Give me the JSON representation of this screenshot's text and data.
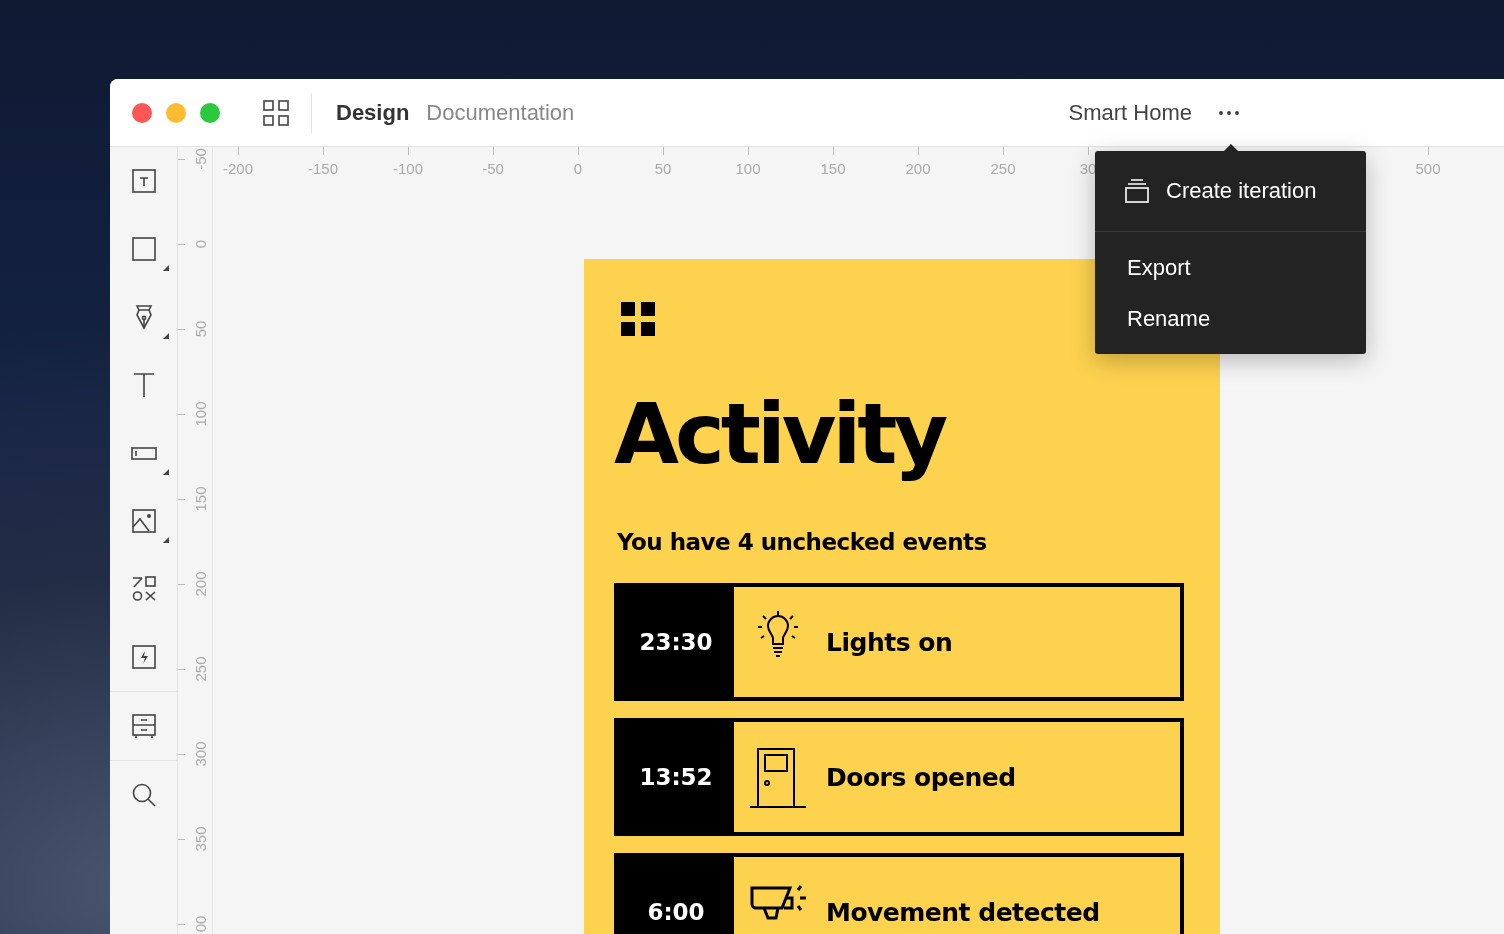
{
  "window": {
    "tabs": [
      {
        "label": "Design",
        "selected": true
      },
      {
        "label": "Documentation",
        "selected": false
      }
    ],
    "project_title": "Smart Home"
  },
  "toolbar": {
    "tool_groups": [
      [
        {
          "has_submenu": false
        },
        {
          "has_submenu": true
        },
        {
          "has_submenu": true
        },
        {
          "has_submenu": false
        },
        {
          "has_submenu": true
        },
        {
          "has_submenu": true
        },
        {
          "has_submenu": false
        },
        {
          "has_submenu": false
        }
      ],
      [
        {
          "has_submenu": false
        }
      ],
      [
        {
          "has_submenu": false
        }
      ]
    ]
  },
  "rulers": {
    "horizontal": [
      "-200",
      "-150",
      "-100",
      "-50",
      "0",
      "50",
      "100",
      "150",
      "200",
      "250",
      "30",
      "500"
    ],
    "vertical": [
      "-50",
      "0",
      "50",
      "100",
      "150",
      "200",
      "250",
      "300",
      "350",
      "00"
    ]
  },
  "menu": {
    "items": [
      {
        "label": "Create iteration",
        "kind": "header"
      },
      {
        "label": "Export",
        "kind": "plain"
      },
      {
        "label": "Rename",
        "kind": "plain"
      }
    ]
  },
  "artboard": {
    "title": "Activity",
    "subtitle": "You have 4 unchecked events",
    "events": [
      {
        "time": "23:30",
        "label": "Lights on"
      },
      {
        "time": "13:52",
        "label": "Doors opened"
      },
      {
        "time": "6:00",
        "label": "Movement detected"
      }
    ]
  }
}
